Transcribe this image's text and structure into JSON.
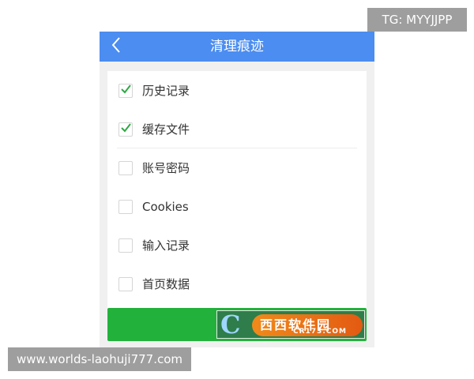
{
  "header": {
    "title": "清理痕迹",
    "back_icon": "chevron-left-icon"
  },
  "options": [
    {
      "label": "历史记录",
      "checked": true
    },
    {
      "label": "缓存文件",
      "checked": true
    },
    {
      "label": "账号密码",
      "checked": false
    },
    {
      "label": "Cookies",
      "checked": false
    },
    {
      "label": "输入记录",
      "checked": false
    },
    {
      "label": "首页数据",
      "checked": false
    }
  ],
  "action_button": {
    "color": "#22b23c"
  },
  "logo": {
    "text": "西西软件园",
    "sub": "CR173.COM"
  },
  "overlays": {
    "top_right": "TG: MYYJJPP",
    "bottom_left": "www.worlds-laohuji777.com"
  },
  "colors": {
    "header": "#4b8df0",
    "check": "#2ea844",
    "button": "#22b23c"
  }
}
